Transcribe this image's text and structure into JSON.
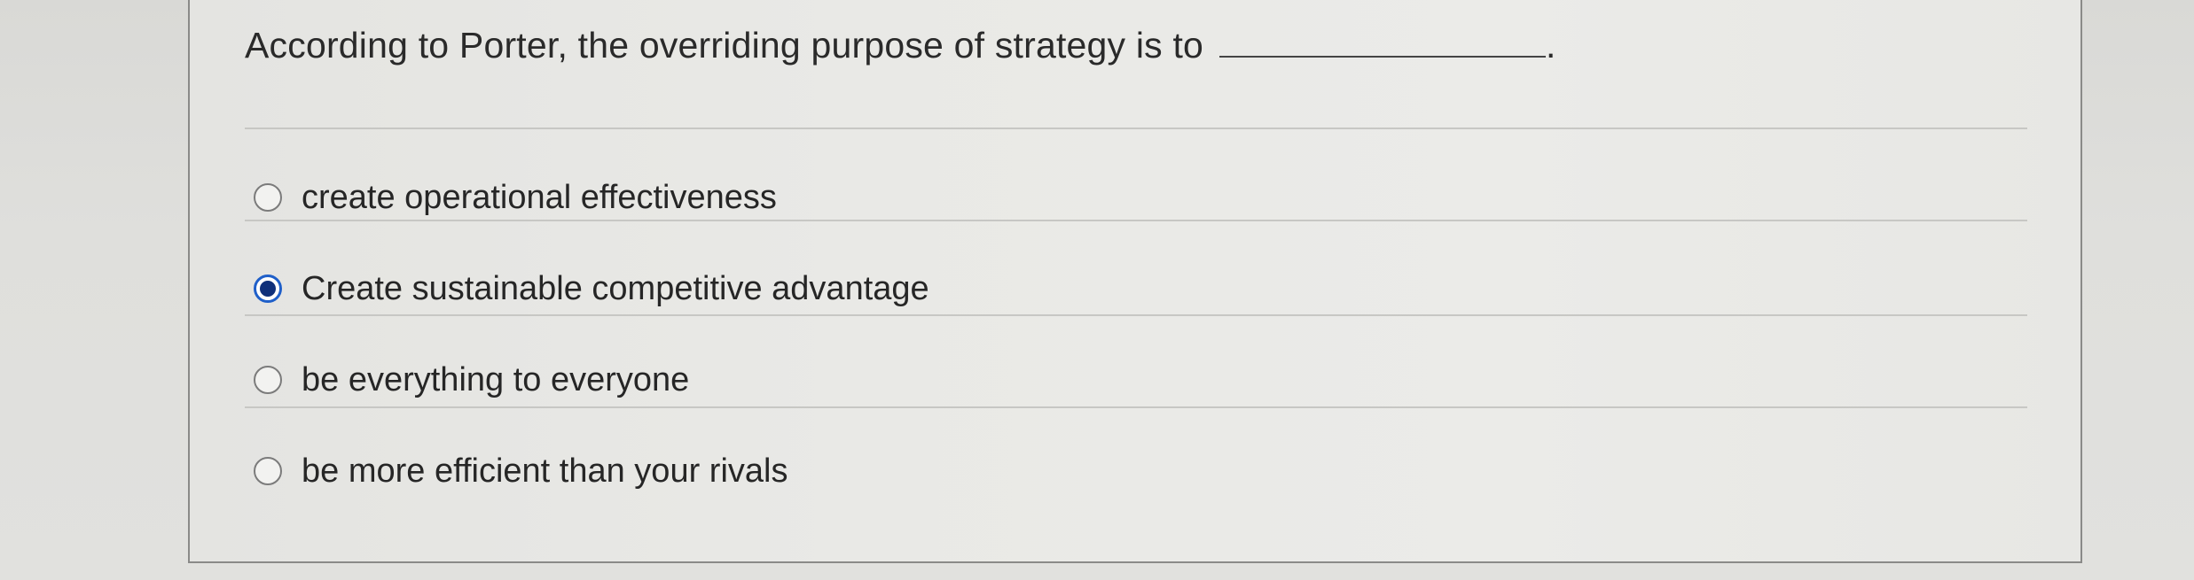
{
  "question": {
    "text": "According to Porter, the overriding purpose of strategy is to",
    "blank_suffix": "."
  },
  "options": [
    {
      "label": "create operational effectiveness",
      "selected": false
    },
    {
      "label": "Create sustainable competitive advantage",
      "selected": true
    },
    {
      "label": "be everything to everyone",
      "selected": false
    },
    {
      "label": "be more efficient than your rivals",
      "selected": false
    }
  ],
  "colors": {
    "selected_radio": "#1f5fc9",
    "text": "#2a2a2a"
  }
}
